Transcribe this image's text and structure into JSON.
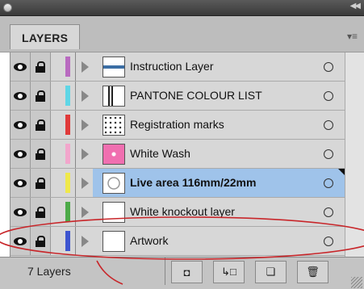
{
  "panel": {
    "tab_label": "LAYERS",
    "menu_icon": "panel-menu-icon",
    "collapse_icon": "double-arrow-icon"
  },
  "layers": [
    {
      "name": "Instruction Layer",
      "color": "#b86ac0",
      "thumb": "instruction-thumb",
      "selected": false
    },
    {
      "name": "PANTONE COLOUR LIST",
      "color": "#5fd6e6",
      "thumb": "list-thumb",
      "selected": false
    },
    {
      "name": "Registration marks",
      "color": "#e03a3a",
      "thumb": "dotted-thumb",
      "selected": false
    },
    {
      "name": "White Wash",
      "color": "#f2a6cc",
      "thumb": "pink-thumb",
      "selected": false
    },
    {
      "name": "Live area 116mm/22mm",
      "color": "#efe84a",
      "thumb": "circle-thumb",
      "selected": true
    },
    {
      "name": "White knockout layer",
      "color": "#4caa48",
      "thumb": "blank-thumb",
      "selected": false
    },
    {
      "name": "Artwork",
      "color": "#3d55d0",
      "thumb": "blank-thumb",
      "selected": false
    }
  ],
  "footer": {
    "count": "7 Layers",
    "buttons": [
      "make-clipping-mask-icon",
      "create-sublayer-icon",
      "new-layer-icon",
      "trash-icon"
    ]
  },
  "annotation": {
    "color": "#c8262a"
  }
}
